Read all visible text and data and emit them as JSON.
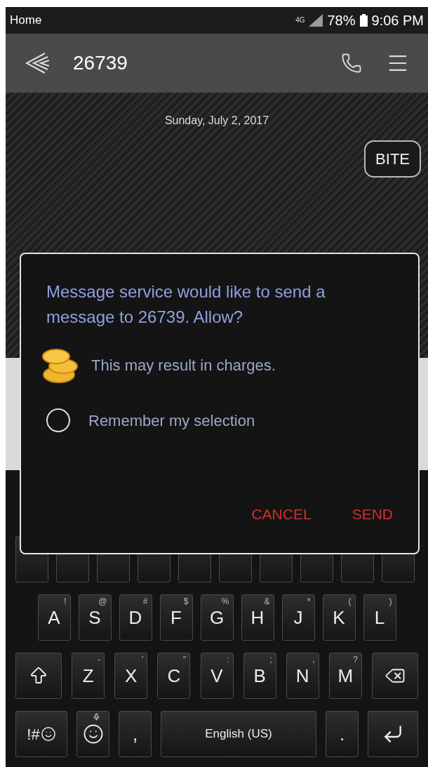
{
  "status_bar": {
    "left": "Home",
    "network": "4G",
    "battery": "78%",
    "time": "9:06 PM"
  },
  "app_bar": {
    "title": "26739"
  },
  "conversation": {
    "date": "Sunday, July 2, 2017",
    "messages": [
      {
        "text": "BITE",
        "outgoing": true
      }
    ]
  },
  "dialog": {
    "message": "Message service would like to send a message to 26739. Allow?",
    "notice": "This may result in charges.",
    "remember": {
      "label": "Remember my selection",
      "checked": false
    },
    "buttons": [
      "CANCEL",
      "SEND"
    ]
  },
  "keyboard": {
    "rows": [
      {
        "keys": [
          {
            "kind": "letter",
            "label": "A",
            "hint": "!"
          },
          {
            "kind": "letter",
            "label": "S",
            "hint": "@"
          },
          {
            "kind": "letter",
            "label": "D",
            "hint": "#"
          },
          {
            "kind": "letter",
            "label": "F",
            "hint": "$"
          },
          {
            "kind": "letter",
            "label": "G",
            "hint": "%"
          },
          {
            "kind": "letter",
            "label": "H",
            "hint": "&"
          },
          {
            "kind": "letter",
            "label": "J",
            "hint": "*"
          },
          {
            "kind": "letter",
            "label": "K",
            "hint": "("
          },
          {
            "kind": "letter",
            "label": "L",
            "hint": ")"
          }
        ]
      },
      {
        "keys": [
          {
            "kind": "shift"
          },
          {
            "kind": "letter",
            "label": "Z",
            "hint": "-"
          },
          {
            "kind": "letter",
            "label": "X",
            "hint": "'"
          },
          {
            "kind": "letter",
            "label": "C",
            "hint": "\""
          },
          {
            "kind": "letter",
            "label": "V",
            "hint": ":"
          },
          {
            "kind": "letter",
            "label": "B",
            "hint": ";"
          },
          {
            "kind": "letter",
            "label": "N",
            "hint": ","
          },
          {
            "kind": "letter",
            "label": "M",
            "hint": "?"
          },
          {
            "kind": "backspace"
          }
        ]
      },
      {
        "keys": [
          {
            "kind": "symbols",
            "label": "!#"
          },
          {
            "kind": "emoji"
          },
          {
            "kind": "letter",
            "label": ","
          },
          {
            "kind": "space",
            "label": "English (US)"
          },
          {
            "kind": "letter",
            "label": "."
          },
          {
            "kind": "enter"
          }
        ]
      }
    ]
  }
}
